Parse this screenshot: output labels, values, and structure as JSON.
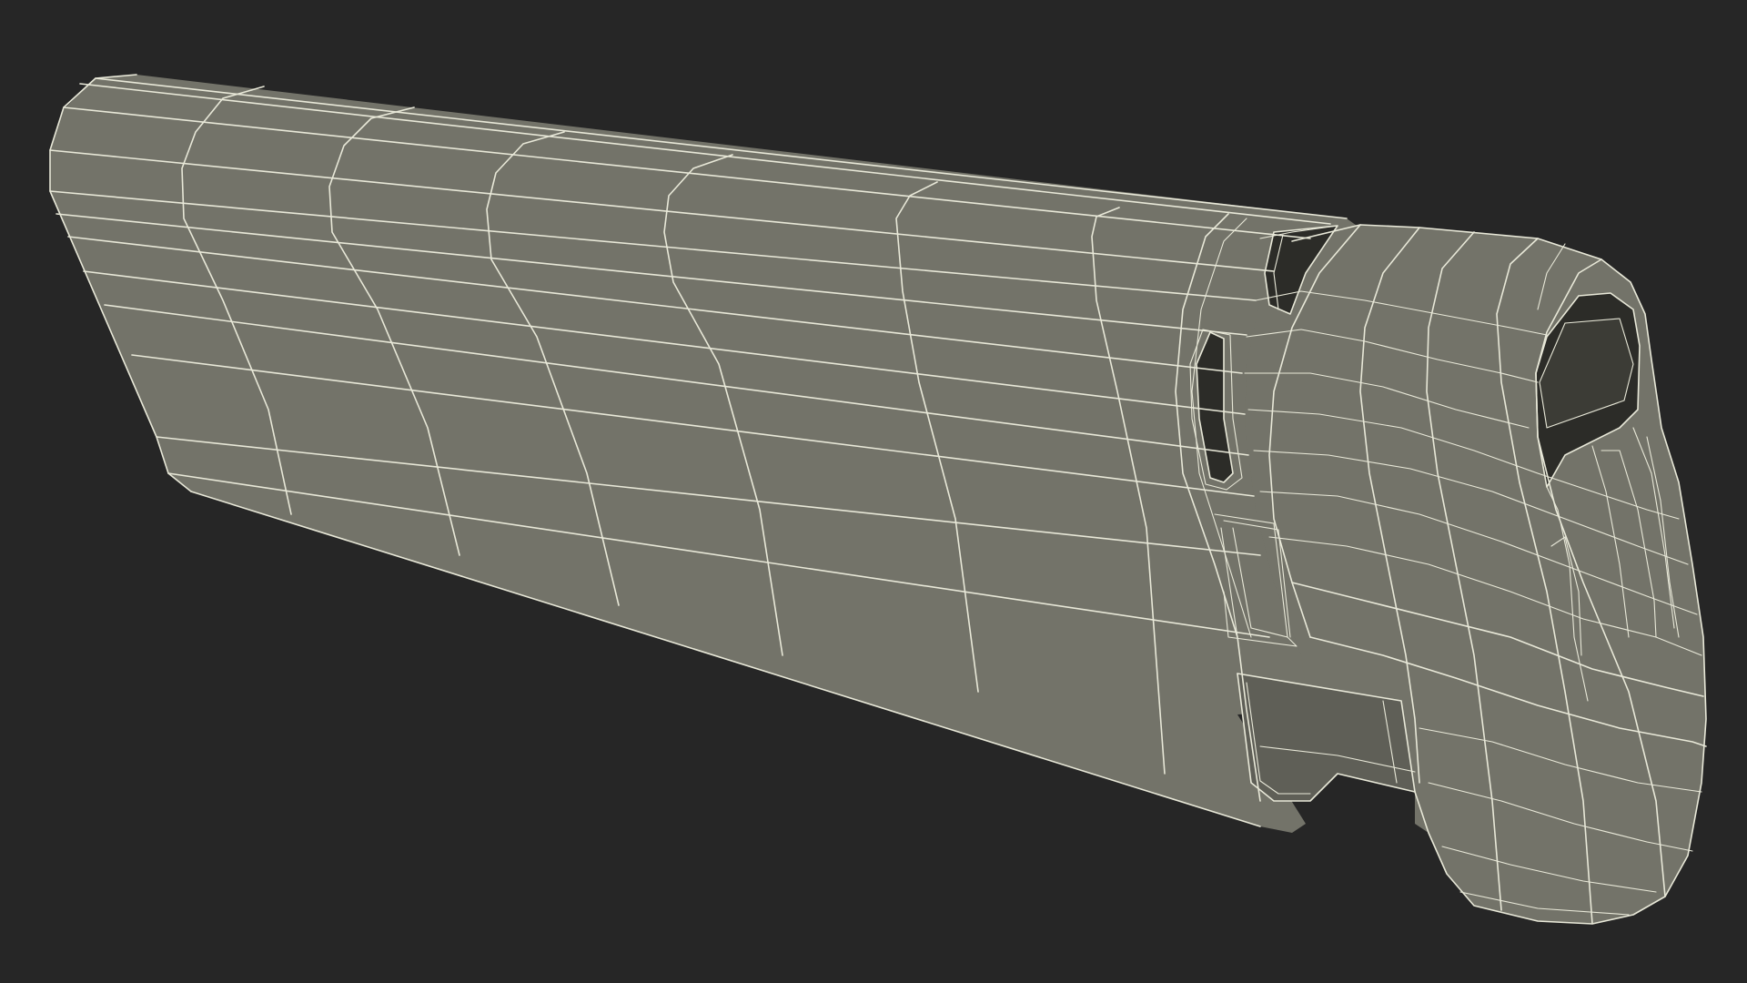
{
  "scene": {
    "background_color": "#262626",
    "model_fill_color": "#737369",
    "wireframe_color": "#e8e8d8"
  }
}
